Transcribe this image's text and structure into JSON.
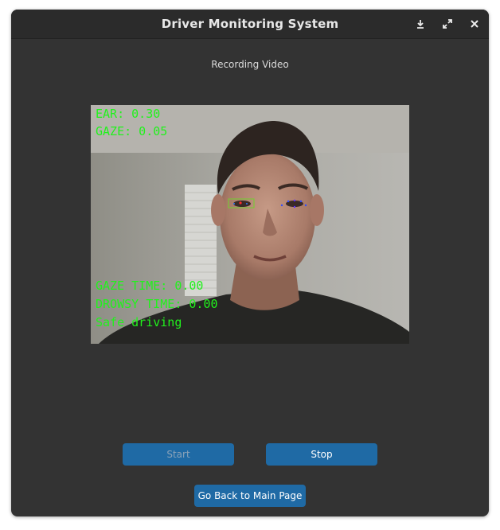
{
  "window": {
    "title": "Driver Monitoring System",
    "controls": {
      "minimize_icon": "download-arrow-icon",
      "maximize_icon": "expand-arrows-icon",
      "close_icon": "close-x-icon"
    }
  },
  "page": {
    "subtitle": "Recording Video"
  },
  "video_feed": {
    "overlays": {
      "ear": "EAR: 0.30",
      "gaze": "GAZE: 0.05",
      "gaze_time": "GAZE TIME: 0.00",
      "drowsy_time": "DROWSY TIME: 0.00",
      "status": "Safe driving"
    },
    "overlay_color": "#21f21c"
  },
  "buttons": {
    "start": "Start",
    "stop": "Stop",
    "back": "Go Back to Main Page"
  },
  "colors": {
    "window_bg": "#333333",
    "titlebar_bg": "#2b2b2b",
    "button_bg": "#1f6aa5",
    "button_disabled_text": "#8aa2b8"
  }
}
